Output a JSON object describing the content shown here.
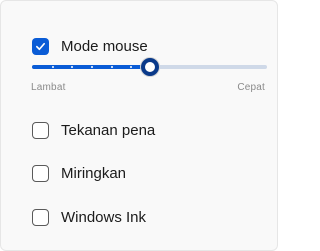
{
  "mouse_mode": {
    "label": "Mode mouse",
    "checked": true
  },
  "speed_slider": {
    "min_label": "Lambat",
    "max_label": "Cepat",
    "value_fraction": 0.5,
    "tick_count": 5
  },
  "pen_pressure": {
    "label": "Tekanan pena",
    "checked": false
  },
  "tilt": {
    "label": "Miringkan",
    "checked": false
  },
  "windows_ink": {
    "label": "Windows Ink",
    "checked": false
  },
  "colors": {
    "accent": "#0a5cd6",
    "thumb_ring": "#0a3a8a",
    "track": "#cfd9e8"
  }
}
